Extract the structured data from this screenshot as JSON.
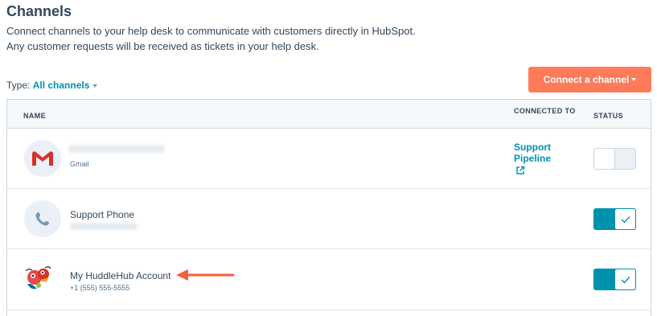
{
  "page": {
    "title": "Channels",
    "description_line1": "Connect channels to your help desk to communicate with customers directly in HubSpot.",
    "description_line2": "Any customer requests will be received as tickets in your help desk."
  },
  "filter": {
    "type_label": "Type:",
    "type_value": "All channels"
  },
  "toolbar": {
    "connect_button": "Connect a channel"
  },
  "table": {
    "headers": {
      "name": "NAME",
      "connected_to": "CONNECTED TO",
      "status": "STATUS"
    },
    "rows": [
      {
        "icon": "gmail-icon",
        "name": "",
        "subtitle": "Gmail",
        "connected_to": "Support Pipeline",
        "status_on": false
      },
      {
        "icon": "phone-icon",
        "name": "Support Phone",
        "subtitle": "",
        "connected_to": "",
        "status_on": true
      },
      {
        "icon": "huddlehub-logo",
        "name": "My HuddleHub Account",
        "subtitle": "+1 (555) 555-5555",
        "connected_to": "",
        "status_on": true
      }
    ]
  },
  "colors": {
    "accent": "#0091ae",
    "cta": "#ff7a59",
    "text": "#33475b",
    "gmail_red": "#d93025",
    "annotation_arrow": "#f2613f"
  }
}
